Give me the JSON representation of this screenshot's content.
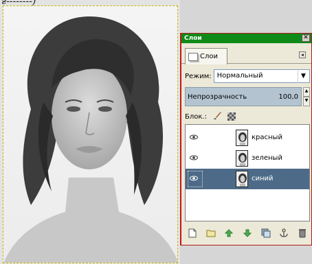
{
  "caption_fragment": "ғ--------)",
  "dock": {
    "title": "Слои",
    "close_glyph": "✕",
    "tab_label": "Слои",
    "tab_menu_glyph": "◂"
  },
  "mode": {
    "label": "Режим:",
    "value": "Нормальный",
    "arrow": "▼"
  },
  "opacity": {
    "label": "Непрозрачность",
    "value": "100,0",
    "spin_up": "▲",
    "spin_down": "▼"
  },
  "lock": {
    "label": "Блок.:"
  },
  "layers": [
    {
      "name": "красный",
      "visible": true,
      "selected": false
    },
    {
      "name": "зеленый",
      "visible": true,
      "selected": false
    },
    {
      "name": "синий",
      "visible": true,
      "selected": true
    }
  ],
  "toolbar_icons": [
    "new-layer-icon",
    "new-layer-group-icon",
    "raise-layer-icon",
    "lower-layer-icon",
    "duplicate-layer-icon",
    "anchor-layer-icon",
    "delete-layer-icon"
  ],
  "colors": {
    "titlebar": "#0f8a18",
    "selected_row": "#4d6b88",
    "opacity_bar": "#b3c4d0",
    "dock_border": "#c01818"
  }
}
